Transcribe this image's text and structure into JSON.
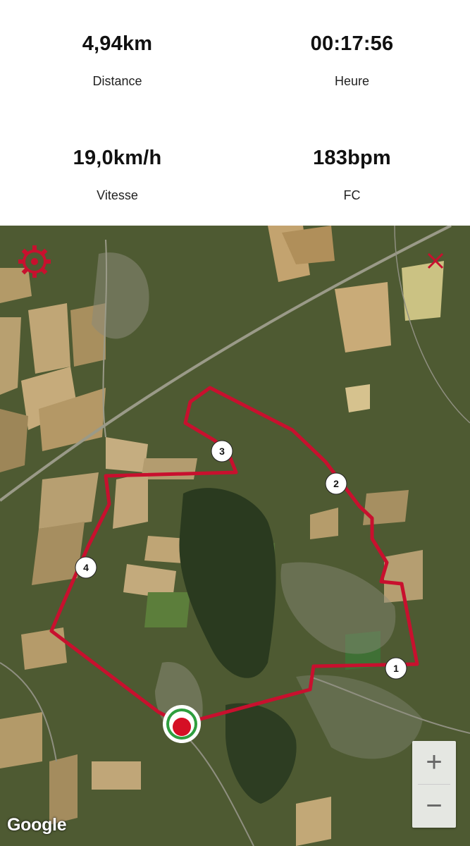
{
  "stats": {
    "distance": {
      "value": "4,94km",
      "label": "Distance"
    },
    "time": {
      "value": "00:17:56",
      "label": "Heure"
    },
    "speed": {
      "value": "19,0km/h",
      "label": "Vitesse"
    },
    "heart_rate": {
      "value": "183bpm",
      "label": "FC"
    }
  },
  "map": {
    "markers": [
      "1",
      "2",
      "3",
      "4"
    ],
    "zoom_in_label": "+",
    "zoom_out_label": "−",
    "attribution": "Google",
    "route_color": "#c8102e",
    "start_marker_colors": {
      "outer": "#ffffff",
      "ring": "#2e9e3e",
      "center": "#d50f25"
    },
    "icons": {
      "settings": "gear-icon",
      "close": "close-icon"
    }
  }
}
